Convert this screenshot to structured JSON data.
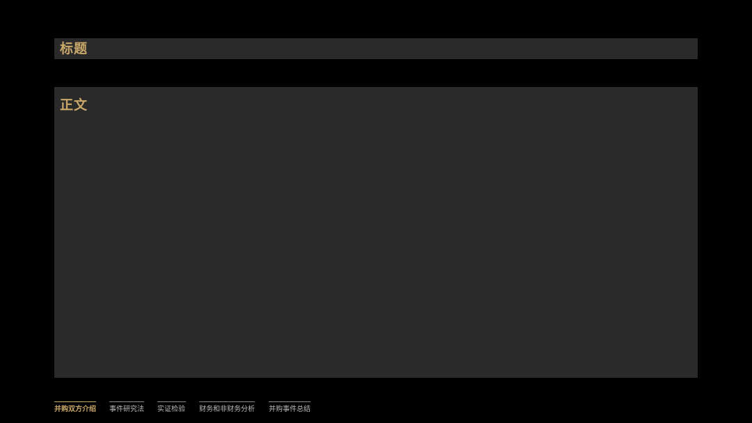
{
  "colors": {
    "background": "#000000",
    "panel": "#2a2a2a",
    "accent_gold": "#c9a86a",
    "nav_inactive_text": "#b9b9b9",
    "nav_inactive_line": "#8a8a8a"
  },
  "header": {
    "title": "标题"
  },
  "main": {
    "body_label": "正文"
  },
  "nav": {
    "active_index": 0,
    "items": [
      {
        "label": "并购双方介绍"
      },
      {
        "label": "事件研究法"
      },
      {
        "label": "实证检验"
      },
      {
        "label": "财务和非财务分析"
      },
      {
        "label": "并购事件总结"
      }
    ]
  }
}
